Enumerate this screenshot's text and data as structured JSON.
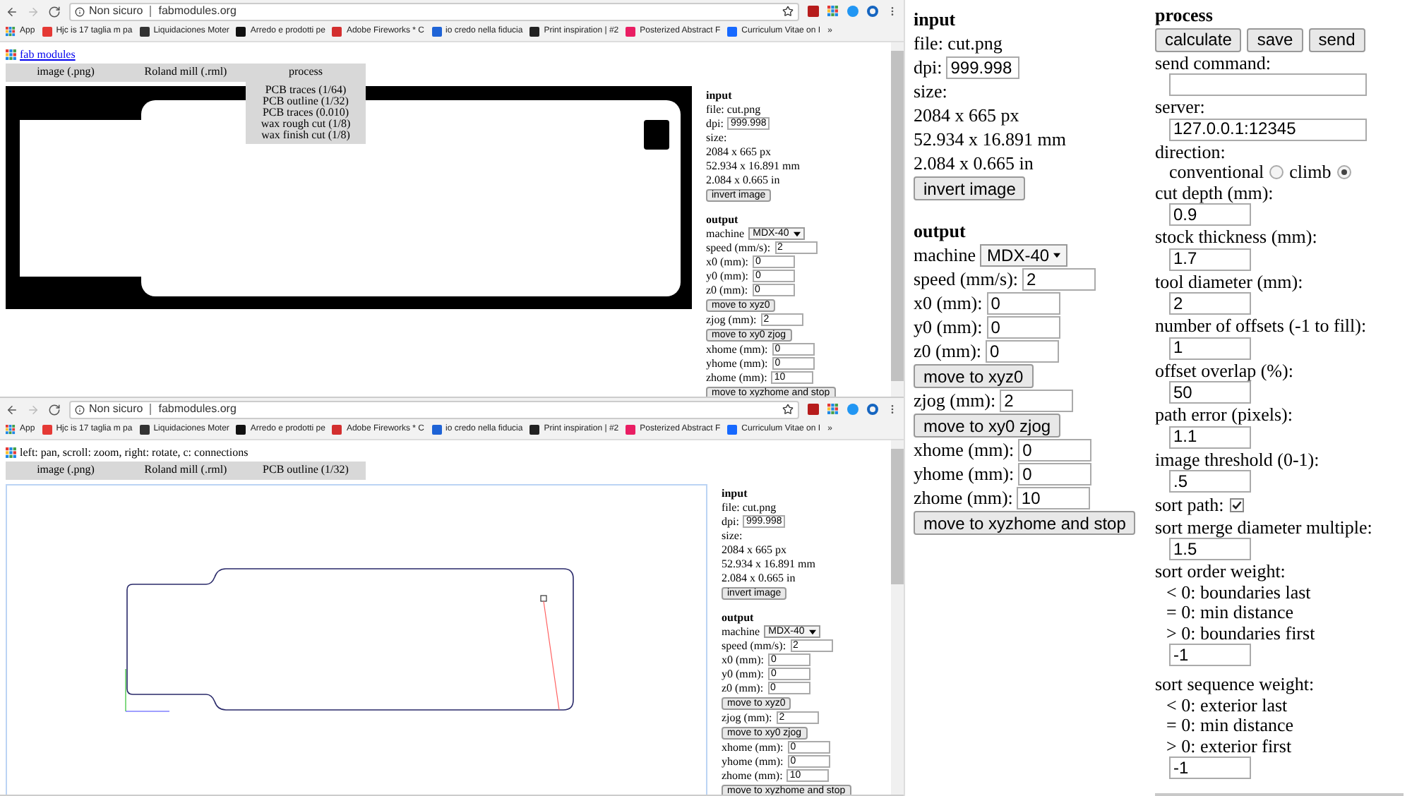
{
  "browsers": [
    {
      "address": {
        "security": "Non sicuro",
        "url": "fabmodules.org"
      },
      "bookmarks": [
        "App",
        "Hjc is 17 taglia m pa",
        "Liquidaciones Moter",
        "Arredo e prodotti pe",
        "Adobe Fireworks * C",
        "io credo nella fiducia",
        "Print inspiration | #2",
        "Posterized Abstract F",
        "Curriculum Vitae on I",
        "»"
      ],
      "header": {
        "kind": "link",
        "text": "fab modules"
      },
      "tabs": [
        "image (.png)",
        "Roland mill (.rml)",
        "process"
      ],
      "menu": [
        "PCB traces (1/64)",
        "PCB outline (1/32)",
        "PCB traces (0.010)",
        "wax rough cut (1/8)",
        "wax finish cut (1/8)"
      ],
      "canvas": {
        "kind": "image"
      },
      "settings": {
        "input": {
          "title": "input",
          "file": "file: cut.png",
          "dpi_label": "dpi:",
          "dpi": "999.998",
          "size_label": "size:",
          "size_lines": [
            "2084 x 665 px",
            "52.934 x 16.891 mm",
            "2.084 x 0.665 in"
          ],
          "invert_button": "invert image"
        },
        "output": {
          "title": "output",
          "rows": [
            {
              "kind": "select",
              "label": "machine",
              "value": "MDX-40"
            },
            {
              "kind": "field",
              "label": "speed (mm/s):",
              "value": "2"
            },
            {
              "kind": "field",
              "label": "x0 (mm):",
              "value": "0"
            },
            {
              "kind": "field",
              "label": "y0 (mm):",
              "value": "0"
            },
            {
              "kind": "field",
              "label": "z0 (mm):",
              "value": "0"
            },
            {
              "kind": "button",
              "label": "move to xyz0"
            },
            {
              "kind": "field",
              "label": "zjog (mm):",
              "value": "2"
            },
            {
              "kind": "button",
              "label": "move to xy0 zjog"
            },
            {
              "kind": "field",
              "label": "xhome (mm):",
              "value": "0"
            },
            {
              "kind": "field",
              "label": "yhome (mm):",
              "value": "0"
            },
            {
              "kind": "field",
              "label": "zhome (mm):",
              "value": "10"
            },
            {
              "kind": "button",
              "label": "move to xyzhome and stop"
            }
          ]
        }
      }
    },
    {
      "address": {
        "security": "Non sicuro",
        "url": "fabmodules.org"
      },
      "bookmarks": [
        "App",
        "Hjc is 17 taglia m pa",
        "Liquidaciones Moter",
        "Arredo e prodotti pe",
        "Adobe Fireworks * C",
        "io credo nella fiducia",
        "Print inspiration | #2",
        "Posterized Abstract F",
        "Curriculum Vitae on I",
        "»"
      ],
      "header": {
        "kind": "hint",
        "text": "left: pan, scroll: zoom, right: rotate, c: connections"
      },
      "tabs": [
        "image (.png)",
        "Roland mill (.rml)",
        "PCB outline (1/32)"
      ],
      "canvas": {
        "kind": "toolpath"
      },
      "settings": {
        "input": {
          "title": "input",
          "file": "file: cut.png",
          "dpi_label": "dpi:",
          "dpi": "999.998",
          "size_label": "size:",
          "size_lines": [
            "2084 x 665 px",
            "52.934 x 16.891 mm",
            "2.084 x 0.665 in"
          ],
          "invert_button": "invert image"
        },
        "output": {
          "title": "output",
          "rows": [
            {
              "kind": "select",
              "label": "machine",
              "value": "MDX-40"
            },
            {
              "kind": "field",
              "label": "speed (mm/s):",
              "value": "2"
            },
            {
              "kind": "field",
              "label": "x0 (mm):",
              "value": "0"
            },
            {
              "kind": "field",
              "label": "y0 (mm):",
              "value": "0"
            },
            {
              "kind": "field",
              "label": "z0 (mm):",
              "value": "0"
            },
            {
              "kind": "button",
              "label": "move to xyz0"
            },
            {
              "kind": "field",
              "label": "zjog (mm):",
              "value": "2"
            },
            {
              "kind": "button",
              "label": "move to xy0 zjog"
            },
            {
              "kind": "field",
              "label": "xhome (mm):",
              "value": "0"
            },
            {
              "kind": "field",
              "label": "yhome (mm):",
              "value": "0"
            },
            {
              "kind": "field",
              "label": "zhome (mm):",
              "value": "10"
            },
            {
              "kind": "button",
              "label": "move to xyzhome and stop"
            }
          ]
        }
      }
    }
  ],
  "settings": {
    "input": {
      "title": "input",
      "file": "file: cut.png",
      "dpi_label": "dpi:",
      "dpi": "999.998",
      "size_label": "size:",
      "size_lines": [
        "2084 x 665 px",
        "52.934 x 16.891 mm",
        "2.084 x 0.665 in"
      ],
      "invert_button": "invert image"
    },
    "output": {
      "title": "output",
      "rows": [
        {
          "kind": "select",
          "label": "machine",
          "value": "MDX-40"
        },
        {
          "kind": "field",
          "label": "speed (mm/s):",
          "value": "2"
        },
        {
          "kind": "field",
          "label": "x0 (mm):",
          "value": "0"
        },
        {
          "kind": "field",
          "label": "y0 (mm):",
          "value": "0"
        },
        {
          "kind": "field",
          "label": "z0 (mm):",
          "value": "0"
        },
        {
          "kind": "button",
          "label": "move to xyz0"
        },
        {
          "kind": "field",
          "label": "zjog (mm):",
          "value": "2"
        },
        {
          "kind": "button",
          "label": "move to xy0 zjog"
        },
        {
          "kind": "field",
          "label": "xhome (mm):",
          "value": "0"
        },
        {
          "kind": "field",
          "label": "yhome (mm):",
          "value": "0"
        },
        {
          "kind": "field",
          "label": "zhome (mm):",
          "value": "10"
        },
        {
          "kind": "button",
          "label": "move to xyzhome and stop"
        }
      ]
    }
  },
  "process": {
    "title": "process",
    "buttons": [
      "calculate",
      "save",
      "send"
    ],
    "rows": [
      {
        "kind": "field",
        "label": "send command:"
      },
      {
        "kind": "field",
        "label": "server:",
        "value": "127.0.0.1:12345"
      },
      {
        "kind": "radio",
        "label": "direction:",
        "options": [
          {
            "label": "conventional",
            "selected": false
          },
          {
            "label": "climb",
            "selected": true
          }
        ]
      },
      {
        "kind": "field",
        "label": "cut depth (mm):",
        "value": "0.9"
      },
      {
        "kind": "field",
        "label": "stock thickness (mm):",
        "value": "1.7"
      },
      {
        "kind": "field",
        "label": "tool diameter (mm):",
        "value": "2"
      },
      {
        "kind": "field",
        "label": "number of offsets (-1 to fill):",
        "value": "1"
      },
      {
        "kind": "field",
        "label": "offset overlap (%):",
        "value": "50"
      },
      {
        "kind": "field",
        "label": "path error (pixels):",
        "value": "1.1"
      },
      {
        "kind": "field",
        "label": "image threshold (0-1):",
        "value": ".5"
      },
      {
        "kind": "checkbox",
        "label": "sort path:",
        "checked": true
      },
      {
        "kind": "field",
        "label": "sort merge diameter multiple:",
        "value": "1.5"
      },
      {
        "kind": "field",
        "label": "sort order weight:",
        "notes": [
          "< 0: boundaries last",
          "= 0: min distance",
          "> 0: boundaries first"
        ],
        "entry": "-1"
      },
      {
        "kind": "field",
        "label": "sort sequence weight:",
        "notes": [
          "< 0: exterior last",
          "= 0: min distance",
          "> 0: exterior first"
        ],
        "entry": "-1"
      }
    ]
  }
}
